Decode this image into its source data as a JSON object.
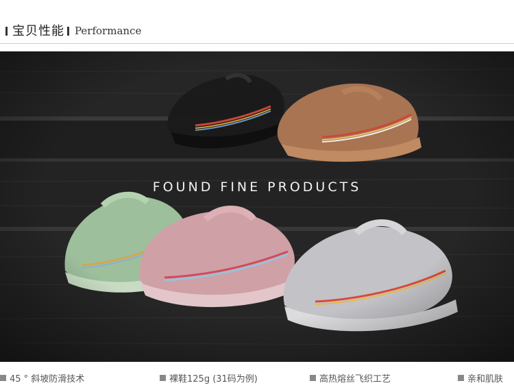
{
  "header": {
    "title_cn": "宝贝性能",
    "title_en": "Performance"
  },
  "photo": {
    "caption": "FOUND FINE PRODUCTS"
  },
  "features": [
    {
      "label": "45 ° 斜坡防滑技术",
      "icon": "square-bullet-icon"
    },
    {
      "label": "裸鞋125g (31码为例)",
      "icon": "square-bullet-icon"
    },
    {
      "label": "高热熔丝飞织工艺",
      "icon": "square-bullet-icon"
    },
    {
      "label": "亲和肌肤",
      "icon": "square-bullet-icon"
    }
  ],
  "colors": {
    "background": "#ffffff",
    "photo_dark": "#1c1c1c",
    "bullet": "#888888",
    "shoe_black": "#1a1a1a",
    "shoe_tan": "#b07a55",
    "shoe_mint": "#a9c9a8",
    "shoe_pink": "#d9a8ad",
    "shoe_white": "#cfcfd2"
  }
}
